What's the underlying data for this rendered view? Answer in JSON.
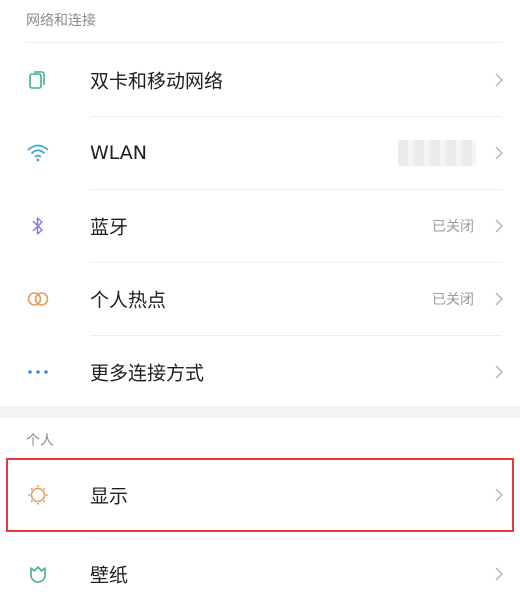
{
  "sections": {
    "network": {
      "header": "网络和连接",
      "items": [
        {
          "label": "双卡和移动网络",
          "icon": "sim-card-icon",
          "status": ""
        },
        {
          "label": "WLAN",
          "icon": "wifi-icon",
          "status": ""
        },
        {
          "label": "蓝牙",
          "icon": "bluetooth-icon",
          "status": "已关闭"
        },
        {
          "label": "个人热点",
          "icon": "hotspot-icon",
          "status": "已关闭"
        },
        {
          "label": "更多连接方式",
          "icon": "more-dots-icon",
          "status": ""
        }
      ]
    },
    "personal": {
      "header": "个人",
      "items": [
        {
          "label": "显示",
          "icon": "display-brightness-icon",
          "status": ""
        },
        {
          "label": "壁纸",
          "icon": "wallpaper-flower-icon",
          "status": ""
        }
      ]
    }
  },
  "colors": {
    "highlight": "#e53a3a",
    "sim_icon": "#3fb38e",
    "wifi_icon": "#3aa7d8",
    "bluetooth_icon": "#8c7cd8",
    "hotspot_icon": "#e39a5a",
    "dots_icon": "#3a8fe0",
    "display_icon": "#e3a05a",
    "wallpaper_icon": "#3fb38e"
  }
}
